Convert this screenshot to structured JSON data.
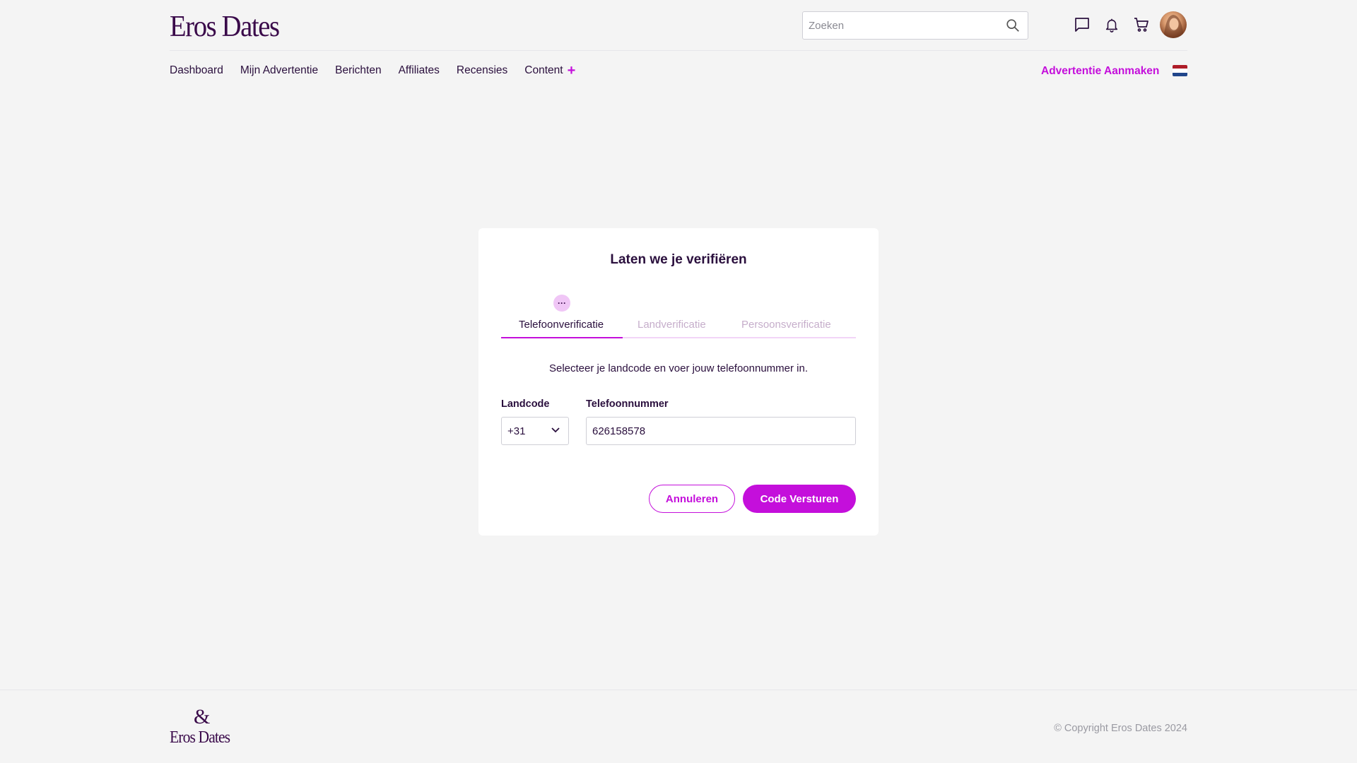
{
  "header": {
    "logo": "Eros Dates",
    "search_placeholder": "Zoeken",
    "icons": [
      "chat-icon",
      "bell-icon",
      "cart-icon"
    ],
    "nav": [
      {
        "label": "Dashboard"
      },
      {
        "label": "Mijn Advertentie"
      },
      {
        "label": "Berichten"
      },
      {
        "label": "Affiliates"
      },
      {
        "label": "Recensies"
      },
      {
        "label": "Content"
      }
    ],
    "create_ad": "Advertentie Aanmaken",
    "flag": "netherlands-flag-icon"
  },
  "modal": {
    "title": "Laten we je verifiëren",
    "step_badge": "···",
    "tabs": [
      {
        "label": "Telefoonverificatie",
        "active": true
      },
      {
        "label": "Landverificatie",
        "active": false
      },
      {
        "label": "Persoonsverificatie",
        "active": false
      }
    ],
    "instruction": "Selecteer je landcode en voer jouw telefoonnummer in.",
    "country_code_label": "Landcode",
    "country_code_value": "+31",
    "phone_label": "Telefoonnummer",
    "phone_value": "626158578",
    "cancel_label": "Annuleren",
    "submit_label": "Code Versturen"
  },
  "footer": {
    "logo_mark": "&",
    "logo": "Eros Dates",
    "copyright": "© Copyright Eros Dates 2024"
  },
  "colors": {
    "accent": "#c40fdb",
    "text": "#2a0f3d",
    "background": "#f4f4f4"
  }
}
